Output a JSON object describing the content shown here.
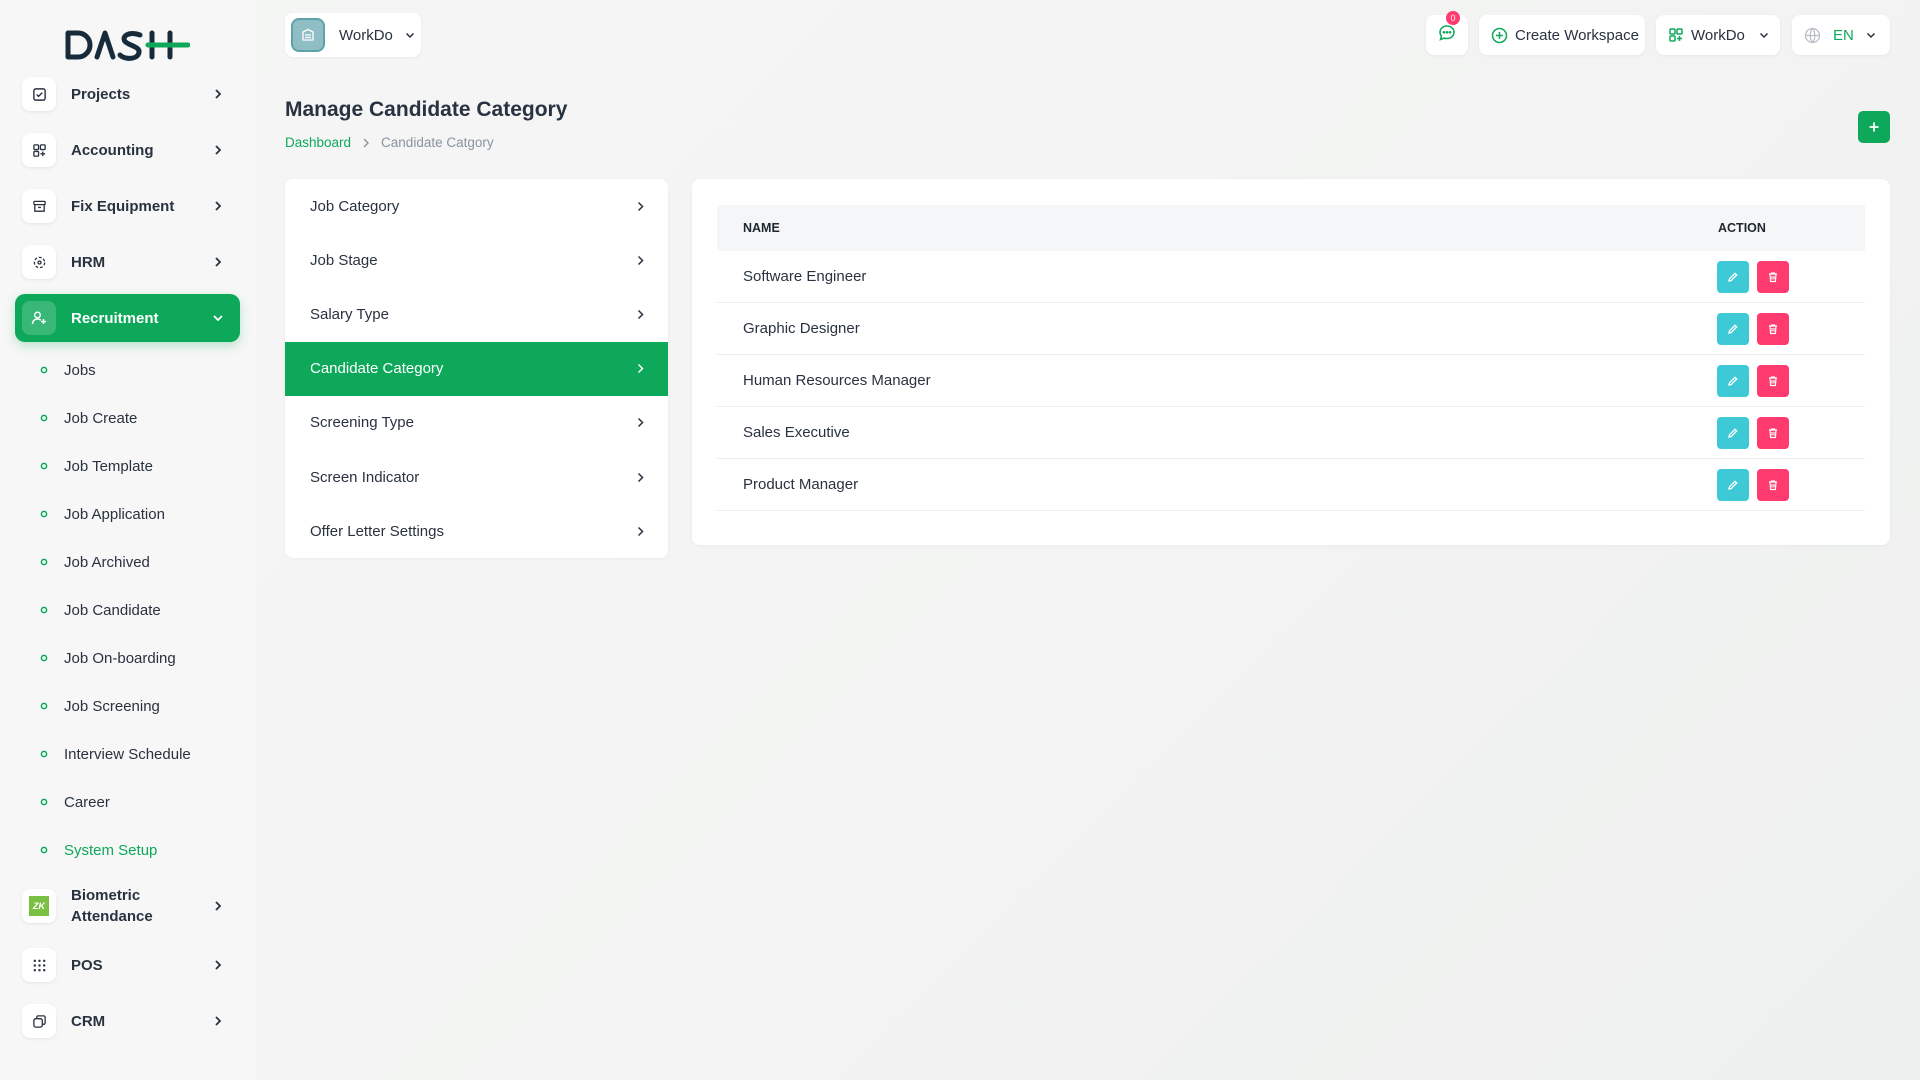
{
  "app": {
    "logo_text": "DASH"
  },
  "colors": {
    "primary": "#0ea85a",
    "edit": "#3ec9d6",
    "delete": "#ff3a6e"
  },
  "sidebar": {
    "items": [
      {
        "label": "Projects",
        "icon": "checkbox-icon"
      },
      {
        "label": "Accounting",
        "icon": "grid-icon"
      },
      {
        "label": "Fix Equipment",
        "icon": "archive-icon"
      },
      {
        "label": "HRM",
        "icon": "hrm-icon"
      },
      {
        "label": "Recruitment",
        "icon": "user-plus-icon"
      },
      {
        "label": "Biometric Attendance",
        "icon": "zk-icon",
        "icon_text": "ZK"
      },
      {
        "label": "POS",
        "icon": "dots-grid-icon"
      },
      {
        "label": "CRM",
        "icon": "crm-icon"
      }
    ],
    "recruitment_sub": [
      "Jobs",
      "Job Create",
      "Job Template",
      "Job Application",
      "Job Archived",
      "Job Candidate",
      "Job On-boarding",
      "Job Screening",
      "Interview Schedule",
      "Career",
      "System Setup"
    ]
  },
  "header": {
    "workspace": "WorkDo",
    "notification_count": "0",
    "create_workspace": "Create Workspace",
    "workspace_menu": "WorkDo",
    "language": "EN"
  },
  "page": {
    "title": "Manage Candidate Category",
    "breadcrumb_home": "Dashboard",
    "breadcrumb_current": "Candidate Catgory"
  },
  "setup_menu": [
    "Job Category",
    "Job Stage",
    "Salary Type",
    "Candidate Category",
    "Screening Type",
    "Screen Indicator",
    "Offer Letter Settings"
  ],
  "table": {
    "headers": {
      "name": "NAME",
      "action": "ACTION"
    },
    "rows": [
      "Software Engineer",
      "Graphic Designer",
      "Human Resources Manager",
      "Sales Executive",
      "Product Manager"
    ]
  }
}
